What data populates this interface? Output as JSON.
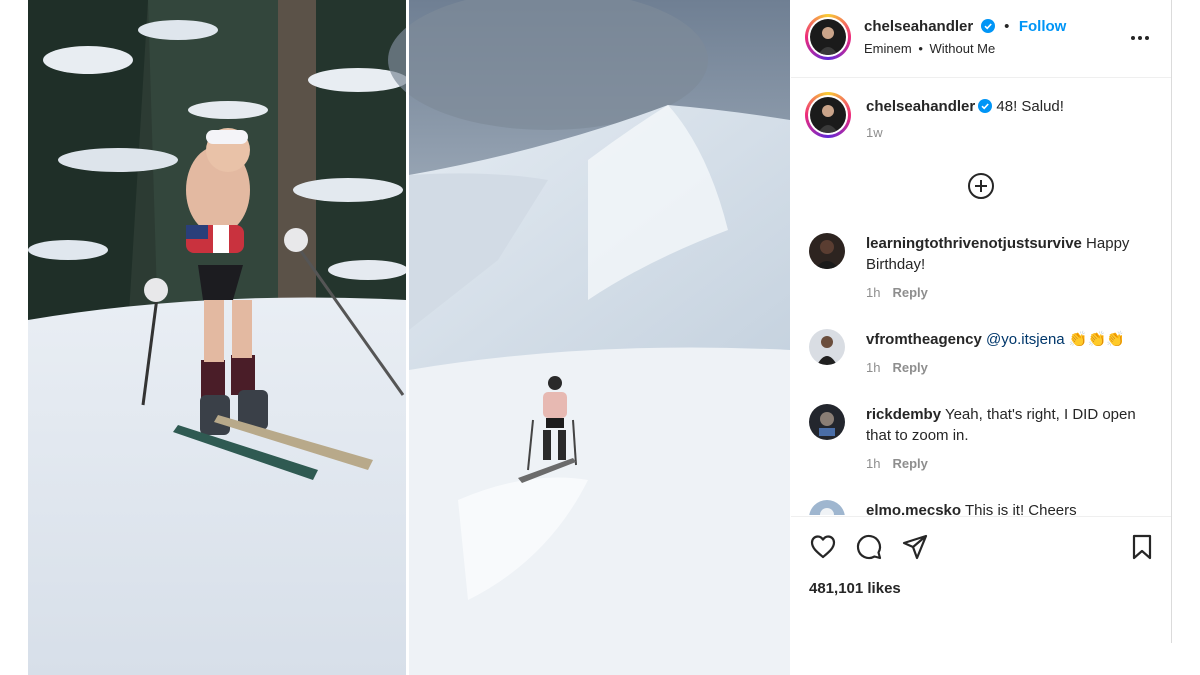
{
  "post": {
    "username": "chelseahandler",
    "follow_label": "Follow",
    "audio": {
      "artist": "Eminem",
      "title": "Without Me"
    },
    "caption": "48! Salud!",
    "caption_time": "1w",
    "likes": "481,101 likes"
  },
  "comments": [
    {
      "username": "learningtothrivenotjustsurvive",
      "text": "Happy Birthday!",
      "time": "1h",
      "reply_label": "Reply"
    },
    {
      "username": "vfromtheagency",
      "mention": "@yo.itsjena",
      "text": "👏👏👏",
      "time": "1h",
      "reply_label": "Reply"
    },
    {
      "username": "rickdemby",
      "text": "Yeah, that's right, I DID open that to zoom in.",
      "time": "1h",
      "reply_label": "Reply"
    },
    {
      "username": "elmo.mecsko",
      "text": "This is it! Cheers"
    }
  ],
  "colors": {
    "follow": "#0095f6",
    "verified": "#0095f6",
    "muted": "#8e8e8e",
    "mention": "#00376b"
  },
  "icons": [
    "verified-badge-icon",
    "more-options-icon",
    "add-comment-icon",
    "heart-icon",
    "comment-icon",
    "share-icon",
    "bookmark-icon"
  ]
}
